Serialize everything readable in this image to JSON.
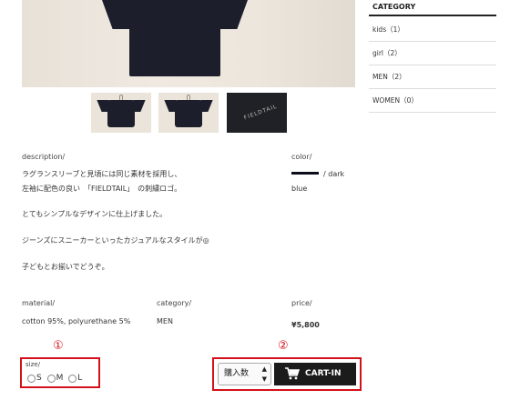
{
  "product": {
    "thumb_logo": "FIELDTAIL",
    "description_label": "description/",
    "description_lines": [
      "ラグランスリーブと見頃には同じ素材を採用し、",
      "左袖に配色の良い　「FIELDTAIL」　の刺繍ロゴ。",
      "とてもシンプルなデザインに仕上げました。",
      "ジーンズにスニーカーといったカジュアルなスタイルが◎",
      "子どもとお揃いでどうぞ。"
    ],
    "color_label": "color/",
    "color_value_1": "/ dark",
    "color_value_2": "blue",
    "swatch_color": "#0b0d1c",
    "material_label": "material/",
    "material_value": "cotton 95%, polyurethane 5%",
    "category_label": "category/",
    "category_value": "MEN",
    "price_label": "price/",
    "price_value": "¥5,800"
  },
  "purchase": {
    "size_label": "size/",
    "sizes": [
      "S",
      "M",
      "L"
    ],
    "quantity_label": "購入数",
    "quantity_arrows": "▲\n▼",
    "cart_label": "CART-IN"
  },
  "annotations": {
    "marker_1": "①",
    "marker_2": "②",
    "highlight_color": "#d6101b"
  },
  "sidebar": {
    "title": "CATEGORY",
    "items": [
      {
        "label": "kids（1）"
      },
      {
        "label": "girl（2）"
      },
      {
        "label": "MEN（2）"
      },
      {
        "label": "WOMEN（0）"
      }
    ]
  }
}
